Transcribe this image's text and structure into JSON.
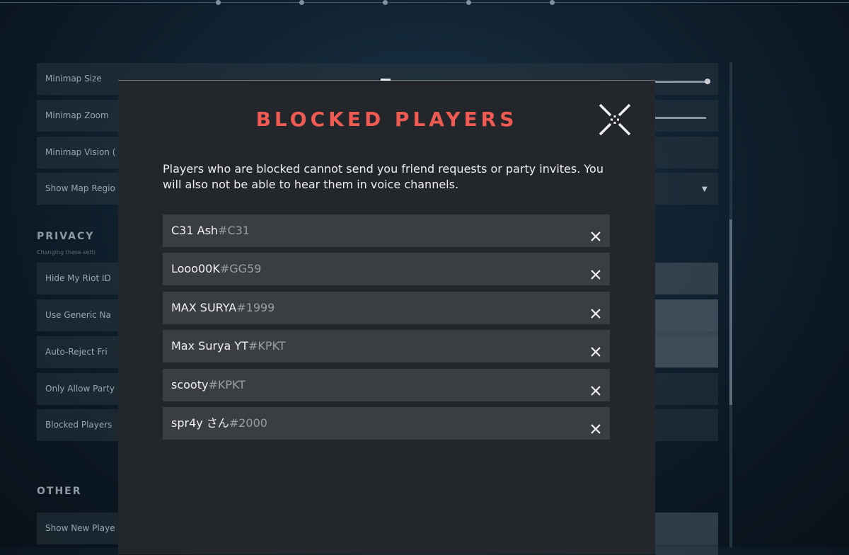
{
  "background": {
    "rows_top": [
      "Minimap Size",
      "Minimap Zoom",
      "Minimap Vision (",
      "Show Map Regio"
    ],
    "privacy_section": "PRIVACY",
    "privacy_note": "Changing these setti",
    "rows_privacy": [
      "Hide My Riot ID",
      "Use Generic Na",
      "Auto-Reject Fri",
      "Only Allow Party",
      "Blocked Players"
    ],
    "other_section": "OTHER",
    "rows_other": [
      "Show New Playe"
    ]
  },
  "modal": {
    "title": "BLOCKED PLAYERS",
    "description": "Players who are blocked cannot send you friend requests or party invites. You will also not be able to hear them in voice channels.",
    "close_icon": "close-crosshair-icon",
    "accent_color": "#ef5a52",
    "players": [
      {
        "name": "C31 Ash",
        "tag": "#C31"
      },
      {
        "name": "Looo00K",
        "tag": "#GG59"
      },
      {
        "name": "MAX SURYA",
        "tag": "#1999"
      },
      {
        "name": "Max Surya YT",
        "tag": "#KPKT"
      },
      {
        "name": "scooty",
        "tag": "#KPKT"
      },
      {
        "name": "spr4y さん",
        "tag": "#2000"
      }
    ]
  }
}
